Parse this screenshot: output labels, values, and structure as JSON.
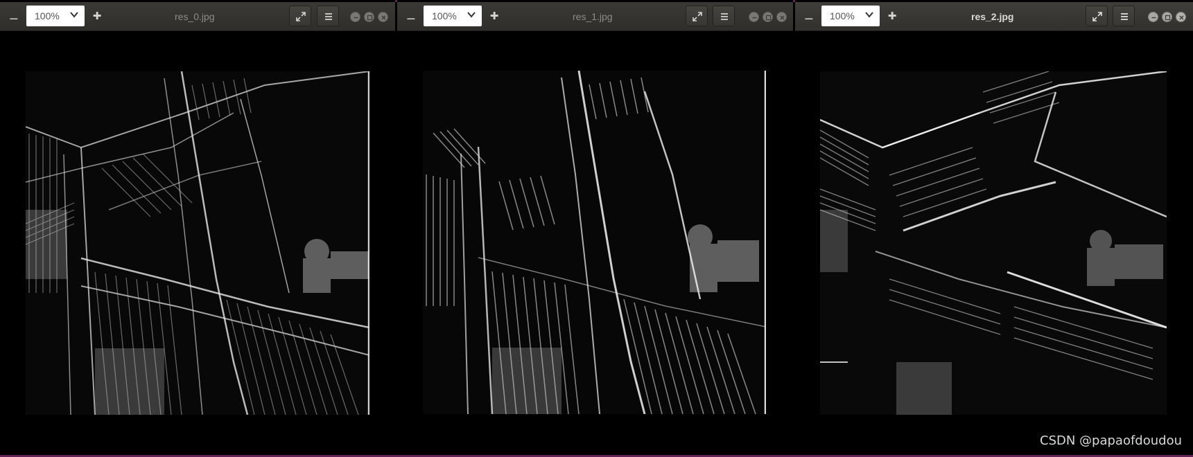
{
  "windows": [
    {
      "title": "res_0.jpg",
      "zoom": "100%",
      "active": false
    },
    {
      "title": "res_1.jpg",
      "zoom": "100%",
      "active": false
    },
    {
      "title": "res_2.jpg",
      "zoom": "100%",
      "active": true
    }
  ],
  "icons": {
    "zoom_out": "minus-icon",
    "zoom_in": "plus-icon",
    "zoom_dropdown": "chevron-down-icon",
    "fullscreen": "fullscreen-icon",
    "menu": "hamburger-menu-icon",
    "minimize": "minimize-icon",
    "maximize": "maximize-icon",
    "close": "close-icon"
  },
  "colors": {
    "desktop_accent": "#5e2750",
    "headerbar": "#3a3935",
    "image_background": "#000000"
  },
  "watermark": "CSDN @papaofdoudou"
}
